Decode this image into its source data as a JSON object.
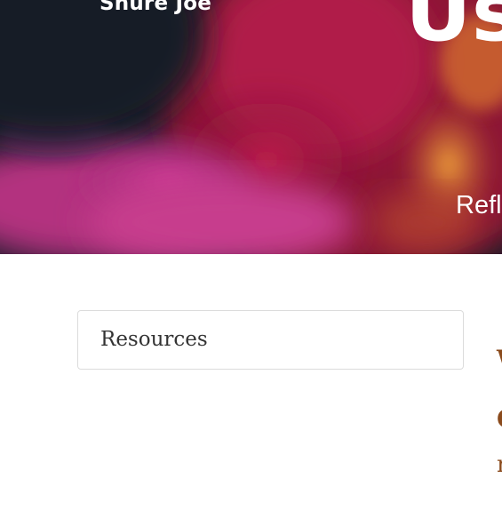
{
  "hero": {
    "author_name": "Shure Joe",
    "title_partial": "Us",
    "subtitle_partial": "Refle"
  },
  "sidebar": {
    "resources_title": "Resources"
  },
  "main": {
    "clipped_glyphs": [
      "W",
      "C",
      "r"
    ]
  },
  "colors": {
    "hero_background": "#141a26",
    "accent_text": "#8a4a1c",
    "card_border": "#dcdcdc"
  }
}
